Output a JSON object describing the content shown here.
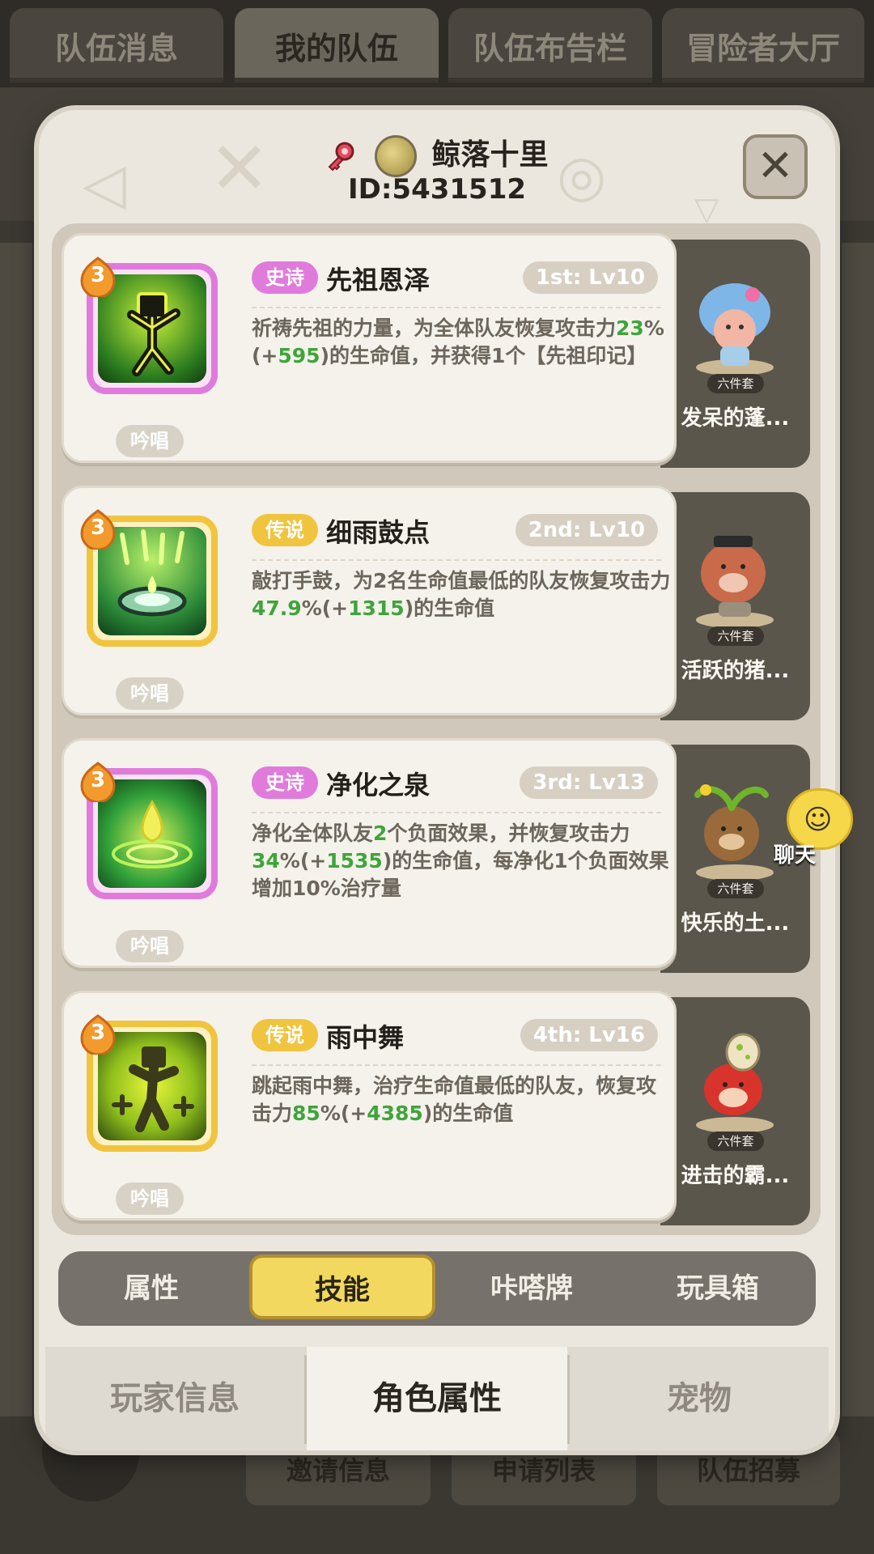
{
  "background": {
    "top_tabs": [
      {
        "label": "队伍消息",
        "active": false
      },
      {
        "label": "我的队伍",
        "active": true
      },
      {
        "label": "队伍布告栏",
        "active": false
      },
      {
        "label": "冒险者大厅",
        "active": false
      }
    ],
    "bottom_buttons": [
      "邀请信息",
      "申请列表",
      "队伍招募"
    ]
  },
  "header": {
    "player_name": "鲸落十里",
    "player_id": "ID:5431512"
  },
  "skills": [
    {
      "level": "3",
      "rarity": "史诗",
      "rarity_type": "epic",
      "name": "先祖恩泽",
      "rank": "1st: Lv10",
      "desc_parts": [
        "祈祷先祖的力量，为全体队友恢复攻击力",
        "23",
        "%(+",
        "595",
        ")的生命值，并获得1个【先祖印记】"
      ],
      "chant": "吟唱",
      "pet_badge": "六件套",
      "pet_name": "发呆的蓬...",
      "icon_color": "#3bb230"
    },
    {
      "level": "3",
      "rarity": "传说",
      "rarity_type": "legend",
      "name": "细雨鼓点",
      "rank": "2nd: Lv10",
      "desc_parts": [
        "敲打手鼓，为2名生命值最低的队友恢复攻击力",
        "47.9",
        "%(+",
        "1315",
        ")的生命值"
      ],
      "chant": "吟唱",
      "pet_badge": "六件套",
      "pet_name": "活跃的猪...",
      "icon_color": "#2f9a3e"
    },
    {
      "level": "3",
      "rarity": "史诗",
      "rarity_type": "epic",
      "name": "净化之泉",
      "rank": "3rd: Lv13",
      "desc_parts": [
        "净化全体队友",
        "2",
        "个负面效果，并恢复攻击力",
        "34",
        "%(+",
        "1535",
        ")的生命值，每净化1个负面效果增加10%治疗量"
      ],
      "chant": "吟唱",
      "pet_badge": "六件套",
      "pet_name": "快乐的土...",
      "icon_color": "#37a33b"
    },
    {
      "level": "3",
      "rarity": "传说",
      "rarity_type": "legend",
      "name": "雨中舞",
      "rank": "4th: Lv16",
      "desc_parts": [
        "跳起雨中舞，治疗生命值最低的队友，恢复攻击力",
        "85",
        "%(+",
        "4385",
        ")的生命值"
      ],
      "chant": "吟唱",
      "pet_badge": "六件套",
      "pet_name": "进击的霸...",
      "icon_color": "#8fbf1c"
    }
  ],
  "sub_tabs": [
    {
      "label": "属性",
      "active": false
    },
    {
      "label": "技能",
      "active": true
    },
    {
      "label": "咔嗒牌",
      "active": false
    },
    {
      "label": "玩具箱",
      "active": false
    }
  ],
  "main_tabs": [
    {
      "label": "玩家信息",
      "active": false
    },
    {
      "label": "角色属性",
      "active": true
    },
    {
      "label": "宠物",
      "active": false
    }
  ],
  "chat": {
    "label": "聊天"
  },
  "close_icon": "close-icon",
  "colors": {
    "epic": "#e07bdc",
    "legend": "#f0c43e",
    "highlight_green": "#3ea53a",
    "active_tab": "#f2d85f"
  }
}
